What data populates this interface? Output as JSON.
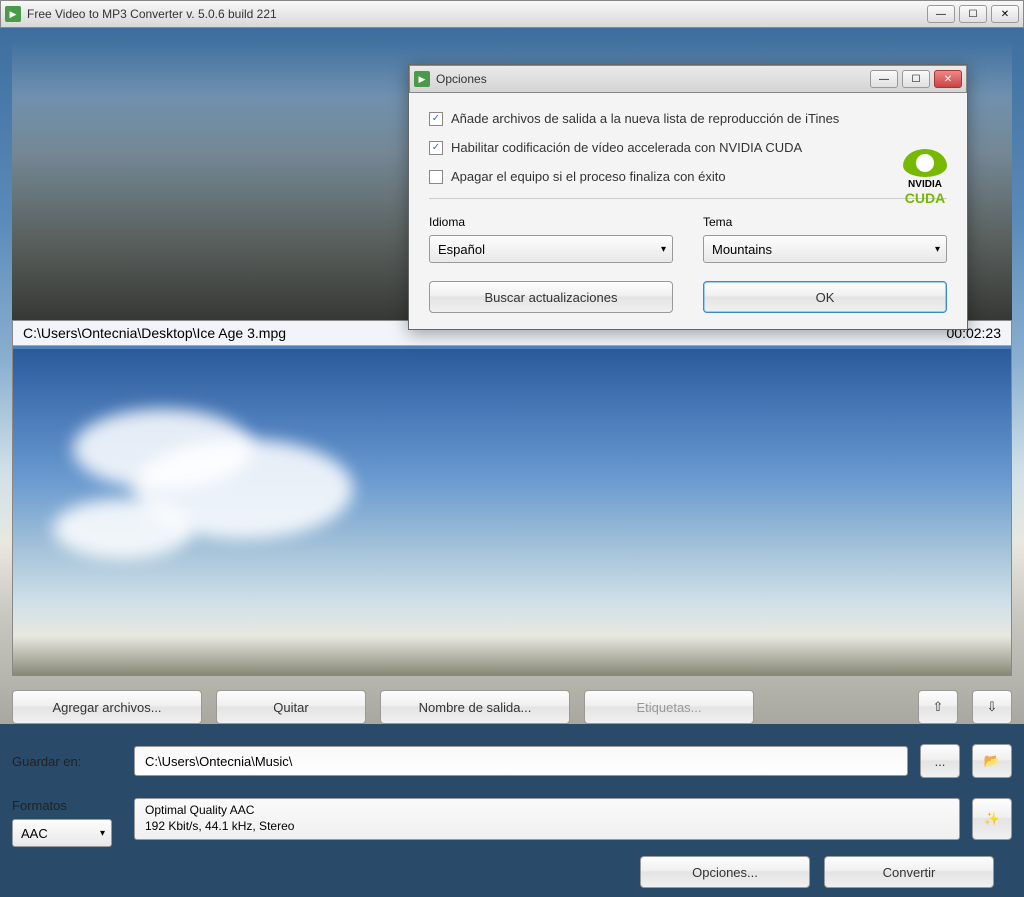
{
  "window": {
    "title": "Free Video to MP3 Converter  v. 5.0.6 build 221"
  },
  "video": {
    "path": "C:\\Users\\Ontecnia\\Desktop\\Ice Age 3.mpg",
    "duration": "00:02:23"
  },
  "toolbar": {
    "add_files": "Agregar archivos...",
    "remove": "Quitar",
    "output_name": "Nombre de salida...",
    "tags": "Etiquetas..."
  },
  "save": {
    "label": "Guardar en:",
    "path": "C:\\Users\\Ontecnia\\Music\\",
    "browse": "..."
  },
  "formats": {
    "label": "Formatos",
    "selected": "AAC",
    "quality_line1": "Optimal Quality AAC",
    "quality_line2": "192 Kbit/s, 44.1 kHz, Stereo"
  },
  "bottom": {
    "options": "Opciones...",
    "convert": "Convertir"
  },
  "dialog": {
    "title": "Opciones",
    "opt1": "Añade archivos de salida a la nueva lista de reproducción de iTines",
    "opt2": "Habilitar codificación de vídeo accelerada con NVIDIA CUDA",
    "opt3": "Apagar el equipo si el proceso finaliza con éxito",
    "lang_label": "Idioma",
    "lang_value": "Español",
    "theme_label": "Tema",
    "theme_value": "Mountains",
    "updates": "Buscar actualizaciones",
    "ok": "OK",
    "nvidia": "NVIDIA",
    "cuda": "CUDA"
  }
}
